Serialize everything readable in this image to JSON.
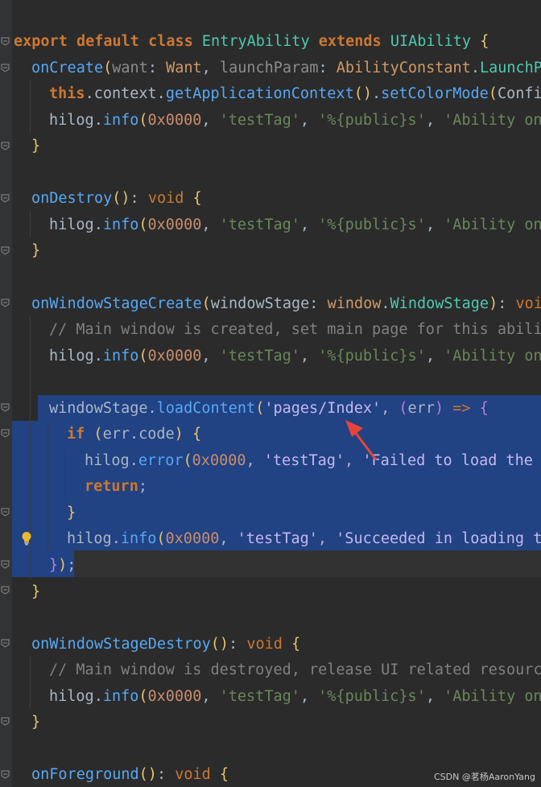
{
  "editor": {
    "lines": [
      {
        "indent": 0,
        "tokens": [
          [
            "kw",
            "export"
          ],
          [
            "id",
            " "
          ],
          [
            "kw",
            "default"
          ],
          [
            "id",
            " "
          ],
          [
            "kw",
            "class"
          ],
          [
            "id",
            " "
          ],
          [
            "cls",
            "EntryAbility"
          ],
          [
            "id",
            " "
          ],
          [
            "kw",
            "extends"
          ],
          [
            "id",
            " "
          ],
          [
            "cls",
            "UIAbility"
          ],
          [
            "id",
            " "
          ],
          [
            "paren2",
            "{"
          ]
        ]
      },
      {
        "indent": 1,
        "tokens": [
          [
            "fn",
            "onCreate"
          ],
          [
            "paren2",
            "("
          ],
          [
            "param",
            "want"
          ],
          [
            "id",
            ": "
          ],
          [
            "type",
            "Want"
          ],
          [
            "id",
            ", "
          ],
          [
            "param",
            "launchParam"
          ],
          [
            "id",
            ": "
          ],
          [
            "type",
            "AbilityConstant"
          ],
          [
            "id",
            "."
          ],
          [
            "cls",
            "LaunchPa"
          ]
        ]
      },
      {
        "indent": 2,
        "tokens": [
          [
            "kw",
            "this"
          ],
          [
            "id",
            ".context."
          ],
          [
            "fn",
            "getApplicationContext"
          ],
          [
            "paren2",
            "()"
          ],
          [
            "id",
            "."
          ],
          [
            "fn",
            "setColorMode"
          ],
          [
            "paren2",
            "("
          ],
          [
            "id",
            "Config"
          ]
        ]
      },
      {
        "indent": 2,
        "tokens": [
          [
            "id",
            "hilog."
          ],
          [
            "fn",
            "info"
          ],
          [
            "paren2",
            "("
          ],
          [
            "num",
            "0x0000"
          ],
          [
            "id",
            ", "
          ],
          [
            "str",
            "'testTag'"
          ],
          [
            "id",
            ", "
          ],
          [
            "str",
            "'%{public}s'"
          ],
          [
            "id",
            ", "
          ],
          [
            "str",
            "'Ability onC"
          ]
        ]
      },
      {
        "indent": 1,
        "tokens": [
          [
            "paren2",
            "}"
          ]
        ]
      },
      {
        "indent": 0,
        "tokens": []
      },
      {
        "indent": 1,
        "tokens": [
          [
            "fn",
            "onDestroy"
          ],
          [
            "paren2",
            "()"
          ],
          [
            "id",
            ": "
          ],
          [
            "kw2",
            "void"
          ],
          [
            "id",
            " "
          ],
          [
            "paren2",
            "{"
          ]
        ]
      },
      {
        "indent": 2,
        "tokens": [
          [
            "id",
            "hilog."
          ],
          [
            "fn",
            "info"
          ],
          [
            "paren2",
            "("
          ],
          [
            "num",
            "0x0000"
          ],
          [
            "id",
            ", "
          ],
          [
            "str",
            "'testTag'"
          ],
          [
            "id",
            ", "
          ],
          [
            "str",
            "'%{public}s'"
          ],
          [
            "id",
            ", "
          ],
          [
            "str",
            "'Ability onD"
          ]
        ]
      },
      {
        "indent": 1,
        "tokens": [
          [
            "paren2",
            "}"
          ]
        ]
      },
      {
        "indent": 0,
        "tokens": []
      },
      {
        "indent": 1,
        "tokens": [
          [
            "fn",
            "onWindowStageCreate"
          ],
          [
            "paren2",
            "("
          ],
          [
            "id",
            "windowStage"
          ],
          [
            "id",
            ": "
          ],
          [
            "type",
            "window"
          ],
          [
            "id",
            "."
          ],
          [
            "cls",
            "WindowStage"
          ],
          [
            "paren2",
            ")"
          ],
          [
            "id",
            ": "
          ],
          [
            "kw2",
            "voic"
          ]
        ]
      },
      {
        "indent": 2,
        "tokens": [
          [
            "cmt",
            "// Main window is created, set main page for this abilit"
          ]
        ]
      },
      {
        "indent": 2,
        "tokens": [
          [
            "id",
            "hilog."
          ],
          [
            "fn",
            "info"
          ],
          [
            "paren2",
            "("
          ],
          [
            "num",
            "0x0000"
          ],
          [
            "id",
            ", "
          ],
          [
            "str",
            "'testTag'"
          ],
          [
            "id",
            ", "
          ],
          [
            "str",
            "'%{public}s'"
          ],
          [
            "id",
            ", "
          ],
          [
            "str",
            "'Ability onW"
          ]
        ]
      },
      {
        "indent": 0,
        "tokens": []
      },
      {
        "indent": 2,
        "tokens": [
          [
            "id",
            "windowStage."
          ],
          [
            "fn",
            "loadContent"
          ],
          [
            "paren2",
            "("
          ],
          [
            "strsel",
            "'pages/Index'"
          ],
          [
            "id",
            ", "
          ],
          [
            "paren1",
            "("
          ],
          [
            "id",
            "err"
          ],
          [
            "paren1",
            ")"
          ],
          [
            "id",
            " "
          ],
          [
            "kw2",
            "=>"
          ],
          [
            "id",
            " "
          ],
          [
            "paren1",
            "{"
          ]
        ]
      },
      {
        "indent": 3,
        "tokens": [
          [
            "kw",
            "if"
          ],
          [
            "id",
            " "
          ],
          [
            "paren2",
            "("
          ],
          [
            "id",
            "err.code"
          ],
          [
            "paren2",
            ")"
          ],
          [
            "id",
            " "
          ],
          [
            "paren2",
            "{"
          ]
        ]
      },
      {
        "indent": 4,
        "tokens": [
          [
            "id",
            "hilog."
          ],
          [
            "fn",
            "error"
          ],
          [
            "paren2",
            "("
          ],
          [
            "num",
            "0x0000"
          ],
          [
            "id",
            ", "
          ],
          [
            "strsel",
            "'testTag'"
          ],
          [
            "id",
            ", "
          ],
          [
            "strsel",
            "'Failed to load the"
          ]
        ]
      },
      {
        "indent": 4,
        "tokens": [
          [
            "kw",
            "return"
          ],
          [
            "id",
            ";"
          ]
        ]
      },
      {
        "indent": 3,
        "tokens": [
          [
            "paren2",
            "}"
          ]
        ]
      },
      {
        "indent": 3,
        "tokens": [
          [
            "id",
            "hilog."
          ],
          [
            "fn",
            "info"
          ],
          [
            "paren2",
            "("
          ],
          [
            "num",
            "0x0000"
          ],
          [
            "id",
            ", "
          ],
          [
            "strsel",
            "'testTag'"
          ],
          [
            "id",
            ", "
          ],
          [
            "strsel",
            "'Succeeded in loading th"
          ]
        ]
      },
      {
        "indent": 2,
        "tokens": [
          [
            "paren1",
            "}"
          ],
          [
            "paren2",
            ")"
          ],
          [
            "id",
            ";"
          ]
        ]
      },
      {
        "indent": 1,
        "tokens": [
          [
            "paren2",
            "}"
          ]
        ]
      },
      {
        "indent": 0,
        "tokens": []
      },
      {
        "indent": 1,
        "tokens": [
          [
            "fn",
            "onWindowStageDestroy"
          ],
          [
            "paren2",
            "()"
          ],
          [
            "id",
            ": "
          ],
          [
            "kw2",
            "void"
          ],
          [
            "id",
            " "
          ],
          [
            "paren2",
            "{"
          ]
        ]
      },
      {
        "indent": 2,
        "tokens": [
          [
            "cmt",
            "// Main window is destroyed, release UI related resource"
          ]
        ]
      },
      {
        "indent": 2,
        "tokens": [
          [
            "id",
            "hilog."
          ],
          [
            "fn",
            "info"
          ],
          [
            "paren2",
            "("
          ],
          [
            "num",
            "0x0000"
          ],
          [
            "id",
            ", "
          ],
          [
            "str",
            "'testTag'"
          ],
          [
            "id",
            ", "
          ],
          [
            "str",
            "'%{public}s'"
          ],
          [
            "id",
            ", "
          ],
          [
            "str",
            "'Ability onW"
          ]
        ]
      },
      {
        "indent": 1,
        "tokens": [
          [
            "paren2",
            "}"
          ]
        ]
      },
      {
        "indent": 0,
        "tokens": []
      },
      {
        "indent": 1,
        "tokens": [
          [
            "fn",
            "onForeground"
          ],
          [
            "paren2",
            "()"
          ],
          [
            "id",
            ": "
          ],
          [
            "kw2",
            "void"
          ],
          [
            "id",
            " "
          ],
          [
            "paren2",
            "{"
          ]
        ]
      }
    ]
  },
  "colors": {
    "background": "#2b2b2b",
    "selection": "#214283",
    "keyword": "#cc7832",
    "function": "#56a8f5",
    "string": "#6a8759",
    "number": "#c98d6b",
    "comment": "#808080",
    "arrow": "#e8433a"
  },
  "icons": {
    "fold": "fold-marker-icon",
    "intention": "lightbulb-icon",
    "annotation": "red-arrow-icon"
  },
  "watermark": {
    "text": "CSDN @茗杨AaronYang"
  }
}
